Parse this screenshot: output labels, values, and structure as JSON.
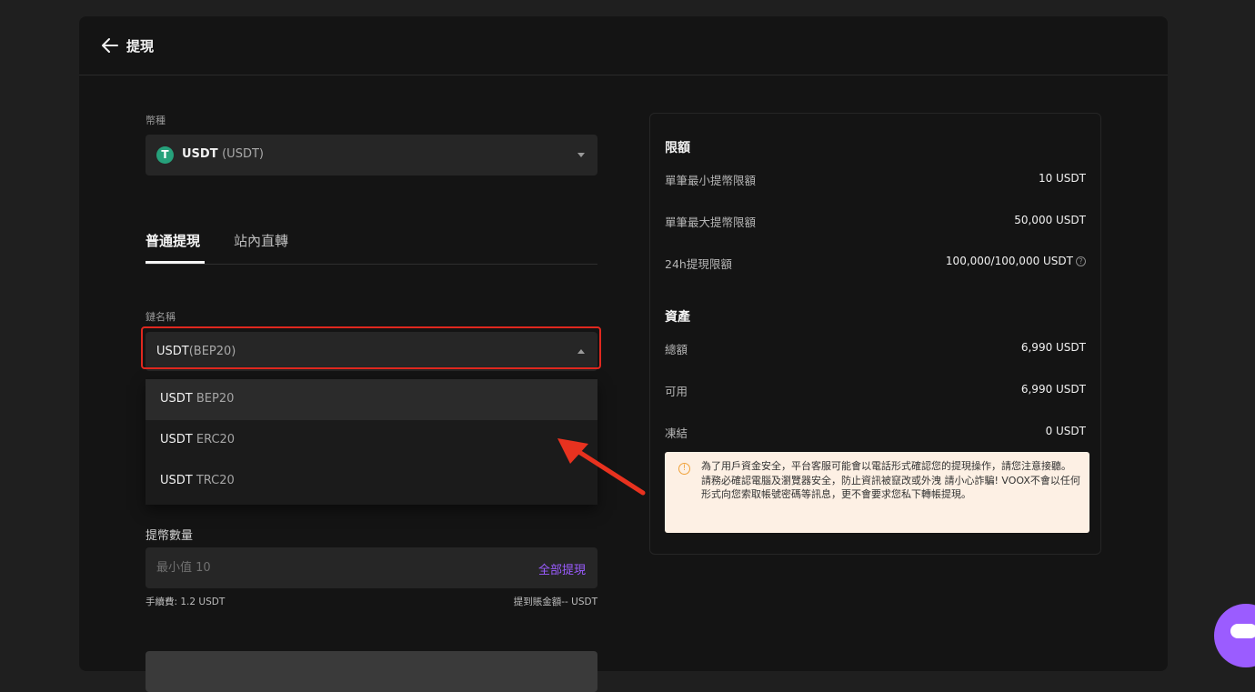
{
  "header": {
    "title": "提現"
  },
  "coin": {
    "label": "幣種",
    "name": "USDT",
    "code": "(USDT)",
    "icon_letter": "T"
  },
  "tabs": [
    {
      "label": "普通提現"
    },
    {
      "label": "站內直轉"
    }
  ],
  "chain": {
    "label": "鏈名稱",
    "selected_name": "USDT",
    "selected_net": "(BEP20)",
    "options": [
      {
        "name": "USDT",
        "net": "BEP20"
      },
      {
        "name": "USDT",
        "net": "ERC20"
      },
      {
        "name": "USDT",
        "net": "TRC20"
      }
    ]
  },
  "quantity": {
    "label": "提幣數量",
    "placeholder": "最小值 10",
    "withdraw_all": "全部提現",
    "fee": "手續費: 1.2 USDT",
    "received": "提到賬金額-- USDT"
  },
  "limits": {
    "title": "限額",
    "rows": [
      {
        "label": "單筆最小提幣限額",
        "value": "10 USDT"
      },
      {
        "label": "單筆最大提幣限額",
        "value": "50,000 USDT"
      },
      {
        "label": "24h提現限額",
        "value": "100,000/100,000 USDT"
      }
    ]
  },
  "assets": {
    "title": "資產",
    "rows": [
      {
        "label": "總額",
        "value": "6,990 USDT"
      },
      {
        "label": "可用",
        "value": "6,990 USDT"
      },
      {
        "label": "凍結",
        "value": "0 USDT"
      }
    ]
  },
  "notice": {
    "text": "為了用戶資金安全，平台客服可能會以電話形式確認您的提現操作，請您注意接聽。 請務必確認電腦及瀏覽器安全，防止資訊被竄改或外洩 請小心詐騙! VOOX不會以任何形式向您索取帳號密碼等訊息，更不會要求您私下轉帳提現。"
  },
  "colors": {
    "accent": "#9b5cff",
    "highlight_border": "#e0281f",
    "tether": "#26a17b",
    "notice_bg": "#fdf0e4"
  }
}
